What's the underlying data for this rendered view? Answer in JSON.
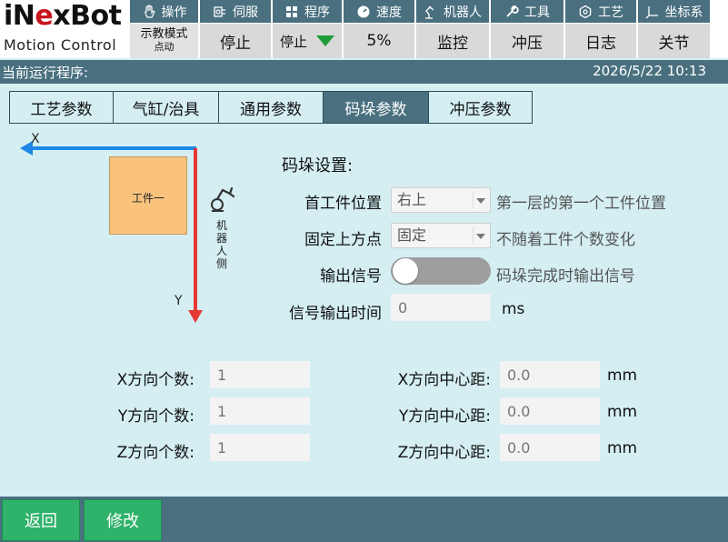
{
  "logo": {
    "brand_pre": "iN",
    "brand_accent": "e",
    "brand_post": "xBot",
    "tagline": "Motion Control"
  },
  "menu": [
    {
      "icon": "hand-icon",
      "label": "操作"
    },
    {
      "icon": "servo-icon",
      "label": "伺服"
    },
    {
      "icon": "program-icon",
      "label": "程序"
    },
    {
      "icon": "speed-icon",
      "label": "速度"
    },
    {
      "icon": "robot-icon",
      "label": "机器人"
    },
    {
      "icon": "wrench-icon",
      "label": "工具"
    },
    {
      "icon": "process-icon",
      "label": "工艺"
    },
    {
      "icon": "coordinate-icon",
      "label": "坐标系"
    }
  ],
  "status": {
    "mode_line1": "示教模式",
    "mode_line2": "点动",
    "state": "停止",
    "run_state": "停止",
    "speed": "5%",
    "monitor": "监控",
    "stamping": "冲压",
    "log": "日志",
    "joint": "关节"
  },
  "infobar": {
    "program_label": "当前运行程序:",
    "datetime": "2026/5/22 10:13"
  },
  "tabs": [
    {
      "label": "工艺参数",
      "active": false
    },
    {
      "label": "气缸/治具",
      "active": false
    },
    {
      "label": "通用参数",
      "active": false
    },
    {
      "label": "码垛参数",
      "active": true
    },
    {
      "label": "冲压参数",
      "active": false
    }
  ],
  "diagram": {
    "x_axis": "X",
    "y_axis": "Y",
    "workpiece": "工件一",
    "robot_side": "机器人侧"
  },
  "settings": {
    "title": "码垛设置:",
    "first_position": {
      "label": "首工件位置",
      "value": "右上",
      "hint": "第一层的第一个工件位置"
    },
    "fixed_top": {
      "label": "固定上方点",
      "value": "固定",
      "hint": "不随着工件个数变化"
    },
    "output_signal": {
      "label": "输出信号",
      "enabled": false,
      "hint": "码垛完成时输出信号"
    },
    "signal_time": {
      "label": "信号输出时间",
      "placeholder": "0",
      "unit": "ms"
    }
  },
  "counts": {
    "x": {
      "label": "X方向个数:",
      "placeholder": "1"
    },
    "y": {
      "label": "Y方向个数:",
      "placeholder": "1"
    },
    "z": {
      "label": "Z方向个数:",
      "placeholder": "1"
    }
  },
  "distances": {
    "x": {
      "label": "X方向中心距:",
      "placeholder": "0.0",
      "unit": "mm"
    },
    "y": {
      "label": "Y方向中心距:",
      "placeholder": "0.0",
      "unit": "mm"
    },
    "z": {
      "label": "Z方向中心距:",
      "placeholder": "0.0",
      "unit": "mm"
    }
  },
  "footer": {
    "back": "返回",
    "modify": "修改"
  },
  "colors": {
    "accent": "#4a7080",
    "background": "#d4eef2",
    "button": "#2fb26a",
    "run_indicator": "#1f9d3a",
    "axis_x": "#1e88e5",
    "axis_y": "#e53935",
    "workpiece": "#f9c37d"
  }
}
